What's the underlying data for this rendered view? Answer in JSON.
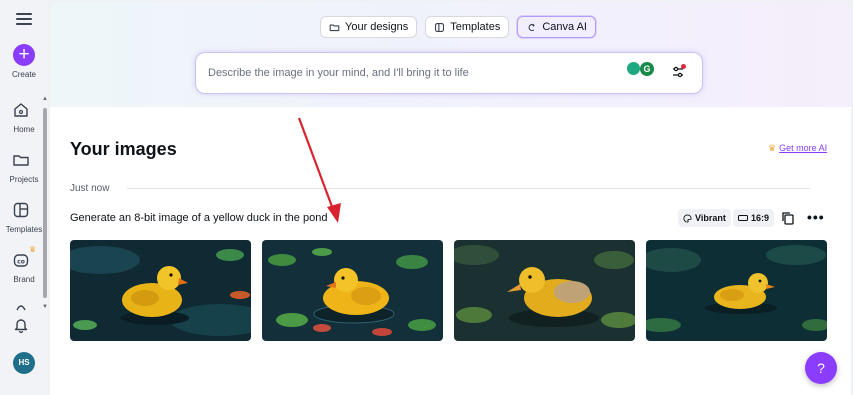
{
  "sidebar": {
    "create_label": "Create",
    "items": [
      {
        "label": "Home",
        "icon": "home-icon"
      },
      {
        "label": "Projects",
        "icon": "folder-icon"
      },
      {
        "label": "Templates",
        "icon": "templates-icon"
      },
      {
        "label": "Brand",
        "icon": "brand-icon"
      }
    ],
    "avatar_initials": "HS"
  },
  "tabs": [
    {
      "label": "Your designs",
      "icon": "folder-icon"
    },
    {
      "label": "Templates",
      "icon": "templates-icon"
    },
    {
      "label": "Canva AI",
      "icon": "canva-ai-icon",
      "active": true
    }
  ],
  "prompt": {
    "placeholder": "Describe the image in your mind, and I'll bring it to life"
  },
  "section": {
    "title": "Your images",
    "get_more_label": "Get more AI",
    "group_label": "Just now",
    "generation_prompt": "Generate an 8-bit image of a yellow duck in the pond",
    "style_chip": "Vibrant",
    "ratio_chip": "16:9"
  },
  "images": [
    {
      "alt": "yellow duck in pond 1"
    },
    {
      "alt": "yellow duck in pond 2"
    },
    {
      "alt": "yellow duck in pond 3"
    },
    {
      "alt": "yellow duck in pond 4"
    }
  ],
  "help_label": "?",
  "colors": {
    "accent": "#8b3dff",
    "arrow": "#d9242f"
  }
}
